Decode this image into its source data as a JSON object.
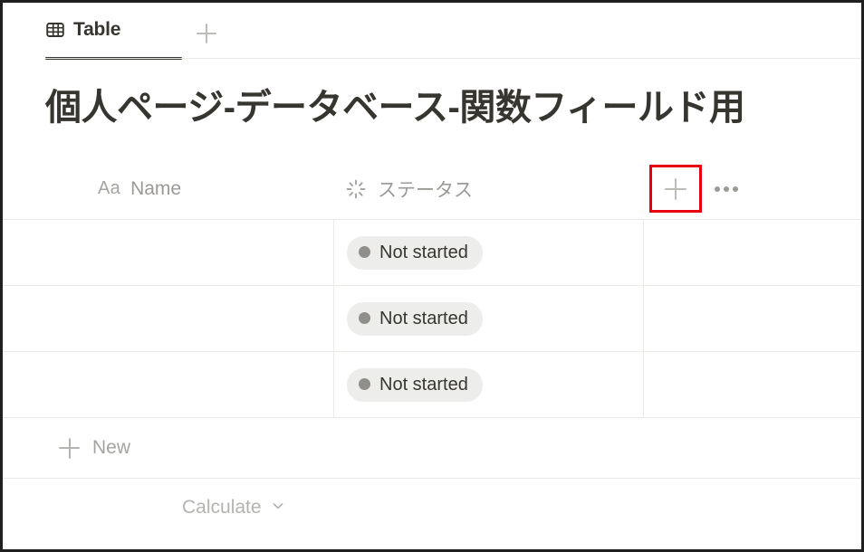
{
  "view_tabs": {
    "active_tab": {
      "label": "Table",
      "icon": "table-icon"
    },
    "add_view": {
      "icon": "plus-icon"
    }
  },
  "database": {
    "title": "個人ページ-データベース-関数フィールド用"
  },
  "table": {
    "columns": [
      {
        "key": "name",
        "label": "Name",
        "type_icon": "text-aa-icon",
        "type_glyph": "Aa"
      },
      {
        "key": "status",
        "label": "ステータス",
        "type_icon": "status-spinner-icon"
      }
    ],
    "header_actions": {
      "add_column": {
        "icon": "plus-icon",
        "highlighted": true,
        "highlight_color": "#e8000d"
      },
      "more_options": {
        "icon": "ellipsis-icon"
      }
    },
    "rows": [
      {
        "name": "",
        "status": {
          "label": "Not started",
          "dot_color": "#918f8c",
          "pill_bg": "#ededec"
        }
      },
      {
        "name": "",
        "status": {
          "label": "Not started",
          "dot_color": "#918f8c",
          "pill_bg": "#ededec"
        }
      },
      {
        "name": "",
        "status": {
          "label": "Not started",
          "dot_color": "#918f8c",
          "pill_bg": "#ededec"
        }
      }
    ],
    "new_row": {
      "label": "New",
      "icon": "plus-icon"
    },
    "footer": {
      "calculate_label": "Calculate",
      "chevron": "chevron-down-icon"
    }
  }
}
